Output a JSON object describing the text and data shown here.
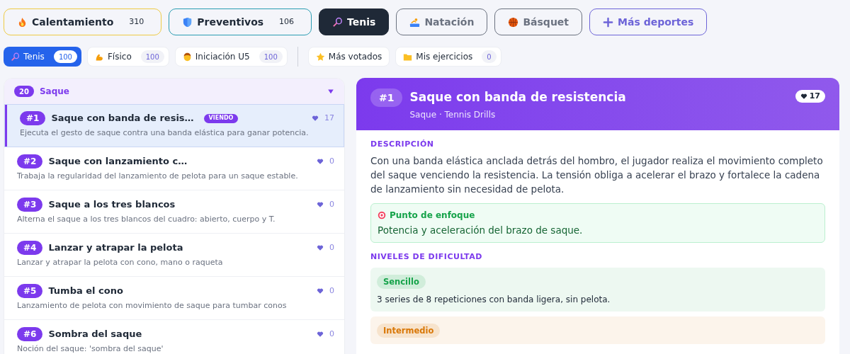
{
  "sports": [
    {
      "label": "Calentamiento",
      "count": "310",
      "color": "#eecb45",
      "selected": false,
      "kind": "sport"
    },
    {
      "label": "Preventivos",
      "count": "106",
      "color": "#2b9db2",
      "selected": false,
      "kind": "sport"
    },
    {
      "label": "Tenis",
      "color": "#1f2937",
      "selected": true,
      "kind": "sport"
    },
    {
      "label": "Natación",
      "color": "#6b7280",
      "selected": false,
      "kind": "sport"
    },
    {
      "label": "Básquet",
      "color": "#6b7280",
      "selected": false,
      "kind": "sport"
    },
    {
      "label": "Más deportes",
      "color": "#6d64d8",
      "selected": false,
      "kind": "add"
    }
  ],
  "category_filters": [
    {
      "label": "Tenis",
      "count": "100",
      "selected": true
    },
    {
      "label": "Físico",
      "count": "100",
      "selected": false
    },
    {
      "label": "Iniciación U5",
      "count": "100",
      "selected": false
    }
  ],
  "view_filters": [
    {
      "label": "Más votados",
      "selected": false
    },
    {
      "label": "Mis ejercicios",
      "count": "0",
      "selected": false
    }
  ],
  "exercise_group": {
    "count": "20",
    "title": "Saque",
    "expanded": true,
    "items": [
      {
        "number": "#1",
        "title": "Saque con banda de resis…",
        "badge": "VIENDO",
        "likes": "17",
        "description": "Ejecuta el gesto de saque contra una banda elástica para ganar potencia.",
        "selected": true
      },
      {
        "number": "#2",
        "title": "Saque con lanzamiento c…",
        "likes": "0",
        "description": "Trabaja la regularidad del lanzamiento de pelota para un saque estable.",
        "selected": false
      },
      {
        "number": "#3",
        "title": "Saque a los tres blancos",
        "likes": "0",
        "description": "Alterna el saque a los tres blancos del cuadro: abierto, cuerpo y T.",
        "selected": false
      },
      {
        "number": "#4",
        "title": "Lanzar y atrapar la pelota",
        "likes": "0",
        "description": "Lanzar y atrapar la pelota con cono, mano o raqueta",
        "selected": false
      },
      {
        "number": "#5",
        "title": "Tumba el cono",
        "likes": "0",
        "description": "Lanzamiento de pelota con movimiento de saque para tumbar conos",
        "selected": false
      },
      {
        "number": "#6",
        "title": "Sombra del saque",
        "likes": "0",
        "description": "Noción del saque: 'sombra del saque'",
        "selected": false
      }
    ]
  },
  "detail": {
    "number": "#1",
    "title": "Saque con banda de resistencia",
    "subtitle": "Saque · Tennis Drills",
    "likes": "17",
    "description_heading": "DESCRIPCIÓN",
    "description": "Con una banda elástica anclada detrás del hombro, el jugador realiza el movimiento completo del saque venciendo la resistencia. La tensión obliga a acelerar el brazo y fortalece la cadena de lanzamiento sin necesidad de pelota.",
    "focus": {
      "title": "Punto de enfoque",
      "text": "Potencia y aceleración del brazo de saque."
    },
    "levels_heading": "NIVELES DE DIFICULTAD",
    "levels": [
      {
        "label": "Sencillo",
        "text": "3 series de 8 repeticiones con banda ligera, sin pelota.",
        "color": "#16a34a"
      },
      {
        "label": "Intermedio",
        "color": "#d97706"
      }
    ]
  }
}
